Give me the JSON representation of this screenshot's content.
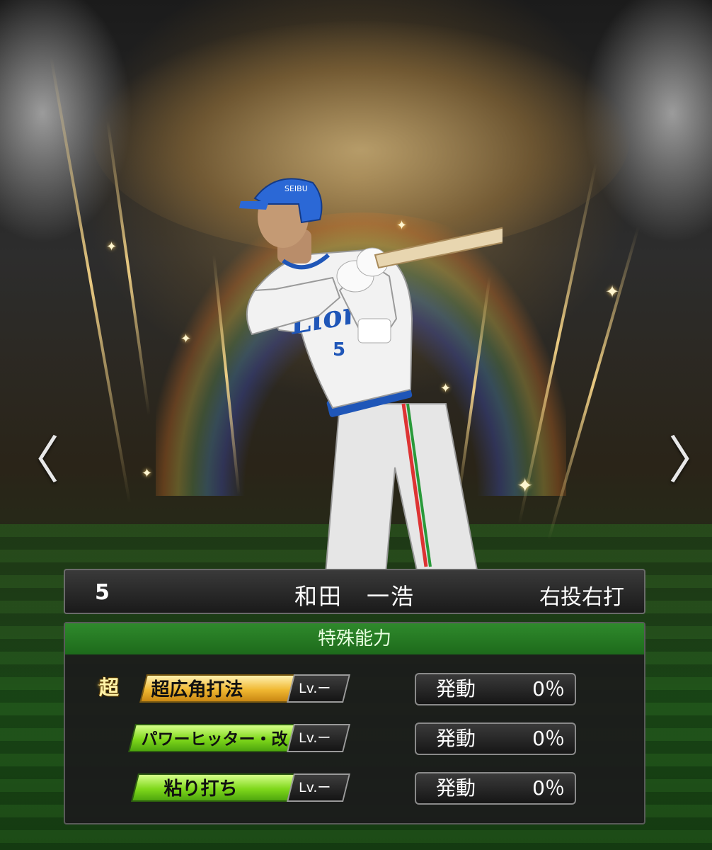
{
  "navigation": {
    "prev_glyph": "〈",
    "next_glyph": "〉"
  },
  "player": {
    "uniform_number": "5",
    "name": "和田　一浩",
    "throw_bat": "右投右打",
    "jersey_team": "Lions",
    "helmet_text": "SEIBU"
  },
  "abilities": {
    "header": "特殊能力",
    "items": [
      {
        "name": "超広角打法",
        "badge": "超",
        "tier": "gold",
        "level": "Lv.ー",
        "stat_label": "発動",
        "stat_value": "0％"
      },
      {
        "name": "パワーヒッター・改",
        "tier": "green",
        "level": "Lv.ー",
        "stat_label": "発動",
        "stat_value": "0％"
      },
      {
        "name": "粘り打ち",
        "tier": "green",
        "level": "Lv.ー",
        "stat_label": "発動",
        "stat_value": "0％"
      }
    ]
  },
  "colors": {
    "gold_tier": "#f0b832",
    "green_tier": "#7fd81b",
    "header_green": "#2f8a2c",
    "jersey_blue": "#1f56b8"
  }
}
